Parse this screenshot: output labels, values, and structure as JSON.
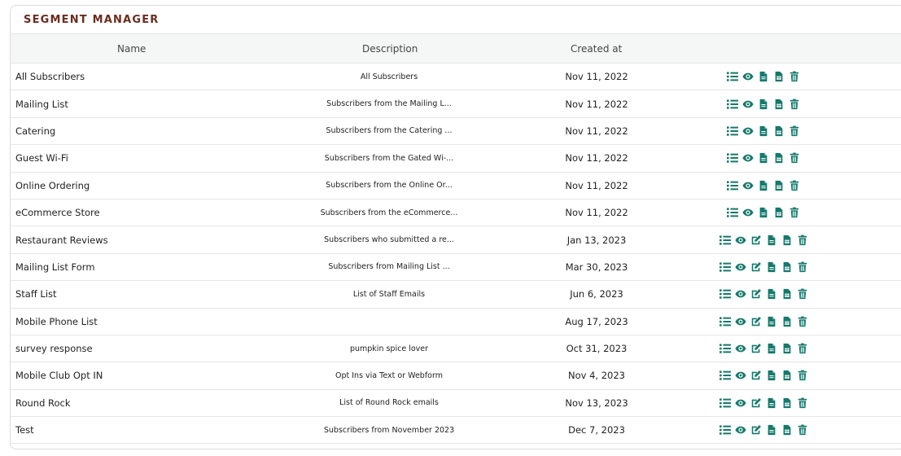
{
  "title": "SEGMENT MANAGER",
  "columns": {
    "name": "Name",
    "description": "Description",
    "created": "Created at"
  },
  "accent_color": "#17786b",
  "title_color": "#6b2c1e",
  "rows": [
    {
      "name": "All Subscribers",
      "description": "All Subscribers",
      "created": "Nov 11, 2022",
      "actions": [
        "list-icon",
        "eye-icon",
        "document-icon",
        "spreadsheet-icon",
        "trash-icon"
      ]
    },
    {
      "name": "Mailing List",
      "description": "Subscribers from the Mailing L...",
      "created": "Nov 11, 2022",
      "actions": [
        "list-icon",
        "eye-icon",
        "document-icon",
        "spreadsheet-icon",
        "trash-icon"
      ]
    },
    {
      "name": "Catering",
      "description": "Subscribers from the Catering ...",
      "created": "Nov 11, 2022",
      "actions": [
        "list-icon",
        "eye-icon",
        "document-icon",
        "spreadsheet-icon",
        "trash-icon"
      ]
    },
    {
      "name": "Guest Wi-Fi",
      "description": "Subscribers from the Gated Wi-...",
      "created": "Nov 11, 2022",
      "actions": [
        "list-icon",
        "eye-icon",
        "document-icon",
        "spreadsheet-icon",
        "trash-icon"
      ]
    },
    {
      "name": "Online Ordering",
      "description": "Subscribers from the Online Or...",
      "created": "Nov 11, 2022",
      "actions": [
        "list-icon",
        "eye-icon",
        "document-icon",
        "spreadsheet-icon",
        "trash-icon"
      ]
    },
    {
      "name": "eCommerce Store",
      "description": "Subscribers from the eCommerce...",
      "created": "Nov 11, 2022",
      "actions": [
        "list-icon",
        "eye-icon",
        "document-icon",
        "spreadsheet-icon",
        "trash-icon"
      ]
    },
    {
      "name": "Restaurant Reviews",
      "description": "Subscribers who submitted a re...",
      "created": "Jan 13, 2023",
      "actions": [
        "list-icon",
        "eye-icon",
        "edit-icon",
        "document-icon",
        "spreadsheet-icon",
        "trash-icon"
      ]
    },
    {
      "name": "Mailing List Form",
      "description": "Subscribers from Mailing List ...",
      "created": "Mar 30, 2023",
      "actions": [
        "list-icon",
        "eye-icon",
        "edit-icon",
        "document-icon",
        "spreadsheet-icon",
        "trash-icon"
      ]
    },
    {
      "name": "Staff List",
      "description": "List of Staff Emails",
      "created": "Jun 6, 2023",
      "actions": [
        "list-icon",
        "eye-icon",
        "edit-icon",
        "document-icon",
        "spreadsheet-icon",
        "trash-icon"
      ]
    },
    {
      "name": "Mobile Phone List",
      "description": "",
      "created": "Aug 17, 2023",
      "actions": [
        "list-icon",
        "eye-icon",
        "edit-icon",
        "document-icon",
        "spreadsheet-icon",
        "trash-icon"
      ]
    },
    {
      "name": "survey response",
      "description": "pumpkin spice lover",
      "created": "Oct 31, 2023",
      "actions": [
        "list-icon",
        "eye-icon",
        "edit-icon",
        "document-icon",
        "spreadsheet-icon",
        "trash-icon"
      ]
    },
    {
      "name": "Mobile Club Opt IN",
      "description": "Opt Ins via Text or Webform",
      "created": "Nov 4, 2023",
      "actions": [
        "list-icon",
        "eye-icon",
        "edit-icon",
        "document-icon",
        "spreadsheet-icon",
        "trash-icon"
      ]
    },
    {
      "name": "Round Rock",
      "description": "List of Round Rock emails",
      "created": "Nov 13, 2023",
      "actions": [
        "list-icon",
        "eye-icon",
        "edit-icon",
        "document-icon",
        "spreadsheet-icon",
        "trash-icon"
      ]
    },
    {
      "name": "Test",
      "description": "Subscribers from November 2023",
      "created": "Dec 7, 2023",
      "actions": [
        "list-icon",
        "eye-icon",
        "edit-icon",
        "document-icon",
        "spreadsheet-icon",
        "trash-icon"
      ]
    }
  ]
}
